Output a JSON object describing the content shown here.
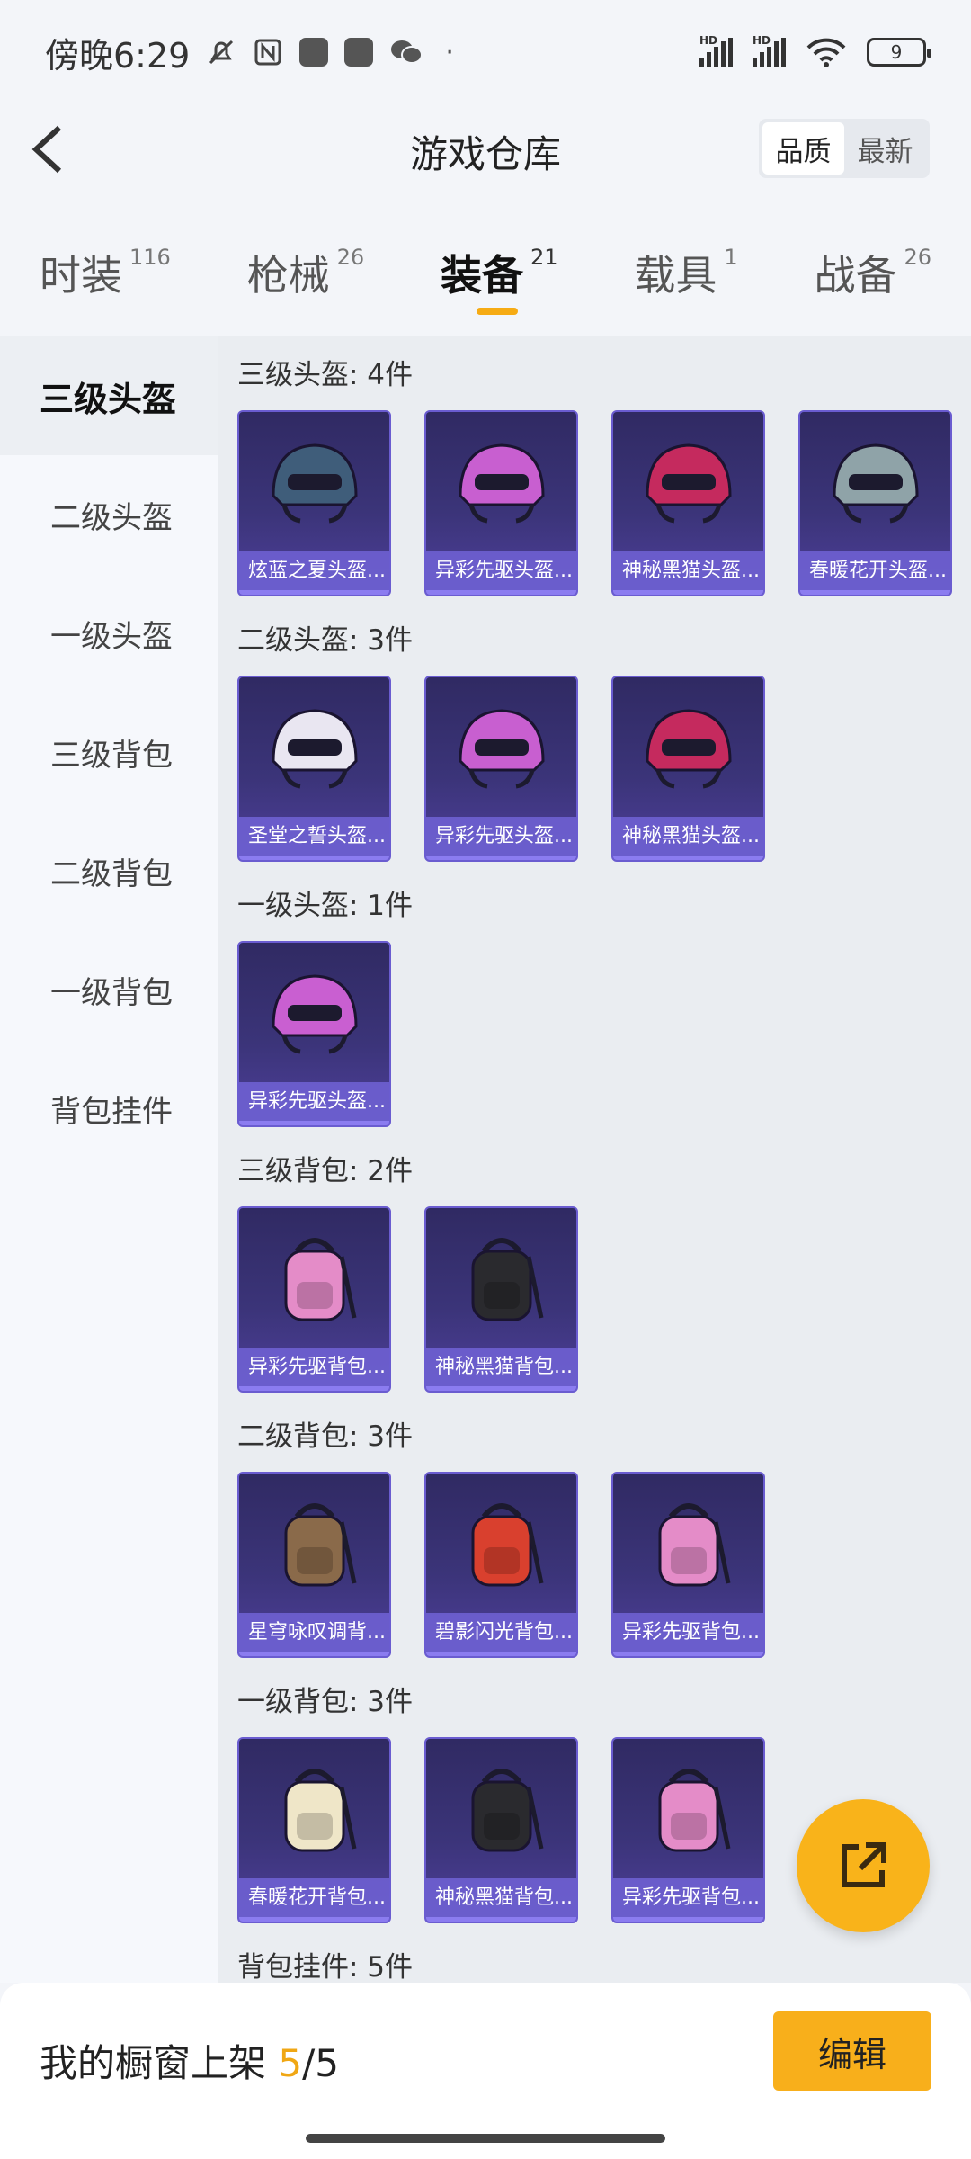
{
  "status_bar": {
    "time": "傍晚6:29",
    "dot": "·",
    "signal1_label": "HD",
    "signal2_label": "HD",
    "battery": "9"
  },
  "header": {
    "title": "游戏仓库",
    "sort_options": [
      "品质",
      "最新"
    ],
    "sort_active": "品质"
  },
  "tabs": [
    {
      "label": "时装",
      "count": "116"
    },
    {
      "label": "枪械",
      "count": "26"
    },
    {
      "label": "装备",
      "count": "21"
    },
    {
      "label": "载具",
      "count": "1"
    },
    {
      "label": "战备",
      "count": "26"
    }
  ],
  "active_tab": "装备",
  "sidebar": {
    "items": [
      "三级头盔",
      "二级头盔",
      "一级头盔",
      "三级背包",
      "二级背包",
      "一级背包",
      "背包挂件"
    ],
    "active": "三级头盔"
  },
  "groups": [
    {
      "title": "三级头盔: 4件",
      "items": [
        {
          "name": "炫蓝之夏头盔...",
          "icon": "helmet-icon",
          "color": "#3f5d7a"
        },
        {
          "name": "异彩先驱头盔...",
          "icon": "helmet-icon",
          "color": "#c85fd0"
        },
        {
          "name": "神秘黑猫头盔...",
          "icon": "helmet-icon",
          "color": "#c52a5e"
        },
        {
          "name": "春暖花开头盔...",
          "icon": "helmet-icon",
          "color": "#8fa3a8"
        }
      ]
    },
    {
      "title": "二级头盔: 3件",
      "items": [
        {
          "name": "圣堂之誓头盔...",
          "icon": "helmet-icon",
          "color": "#e9e6f1"
        },
        {
          "name": "异彩先驱头盔...",
          "icon": "helmet-icon",
          "color": "#c85fd0"
        },
        {
          "name": "神秘黑猫头盔...",
          "icon": "helmet-icon",
          "color": "#c52a5e"
        }
      ]
    },
    {
      "title": "一级头盔: 1件",
      "items": [
        {
          "name": "异彩先驱头盔...",
          "icon": "helmet-icon",
          "color": "#c95fd1"
        }
      ]
    },
    {
      "title": "三级背包: 2件",
      "items": [
        {
          "name": "异彩先驱背包...",
          "icon": "backpack-icon",
          "color": "#e48cc8"
        },
        {
          "name": "神秘黑猫背包...",
          "icon": "backpack-icon",
          "color": "#2a2a2e"
        }
      ]
    },
    {
      "title": "二级背包: 3件",
      "items": [
        {
          "name": "星穹咏叹调背...",
          "icon": "backpack-icon",
          "color": "#8a6a4a"
        },
        {
          "name": "碧影闪光背包...",
          "icon": "backpack-icon",
          "color": "#d9402e"
        },
        {
          "name": "异彩先驱背包...",
          "icon": "backpack-icon",
          "color": "#e48cc8"
        }
      ]
    },
    {
      "title": "一级背包: 3件",
      "items": [
        {
          "name": "春暖花开背包...",
          "icon": "backpack-icon",
          "color": "#efe6c8"
        },
        {
          "name": "神秘黑猫背包...",
          "icon": "backpack-icon",
          "color": "#2a2a2e"
        },
        {
          "name": "异彩先驱背包...",
          "icon": "backpack-icon",
          "color": "#e48cc8"
        }
      ]
    },
    {
      "title": "背包挂件: 5件",
      "items": []
    }
  ],
  "bottom_bar": {
    "label": "我的橱窗上架",
    "count_current": "5",
    "count_separator": "/",
    "count_total": "5",
    "edit_label": "编辑"
  },
  "colors": {
    "accent": "#f8af1b",
    "card_bg": "#3b3479",
    "card_caption": "#6e60d2"
  }
}
